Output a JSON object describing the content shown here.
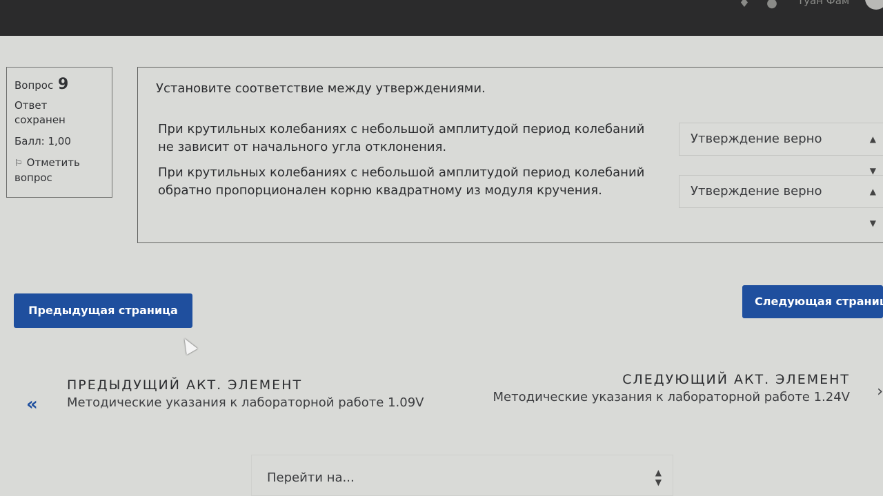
{
  "topbar": {
    "user_name": "Туан Фам",
    "icons": [
      "bell-icon",
      "chat-icon"
    ]
  },
  "question_info": {
    "question_label": "Вопрос",
    "question_number": "9",
    "state": "Ответ сохранен",
    "grade": "Балл: 1,00",
    "flag_label": "Отметить вопрос"
  },
  "question": {
    "text": "Установите соответствие между утверждениями.",
    "rows": [
      {
        "statement": "При крутильных колебаниях с небольшой амплитудой период колебаний не зависит от начального угла отклонения.",
        "selected": "Утверждение верно"
      },
      {
        "statement": "При крутильных колебаниях с небольшой амплитудой период колебаний обратно пропорционален корню квадратному из модуля кручения.",
        "selected": "Утверждение верно"
      }
    ]
  },
  "navigation": {
    "prev_page_label": "Предыдущая страница",
    "next_page_label": "Следующая страница"
  },
  "activity_nav": {
    "prev_label": "ПРЕДЫДУЩИЙ АКТ. ЭЛЕМЕНТ",
    "prev_name": "Методические указания к лабораторной работе 1.09V",
    "next_label": "СЛЕДУЮЩИЙ АКТ. ЭЛЕМЕНТ",
    "next_name": "Методические указания к лабораторной работе 1.24V"
  },
  "jump": {
    "placeholder": "Перейти на..."
  }
}
